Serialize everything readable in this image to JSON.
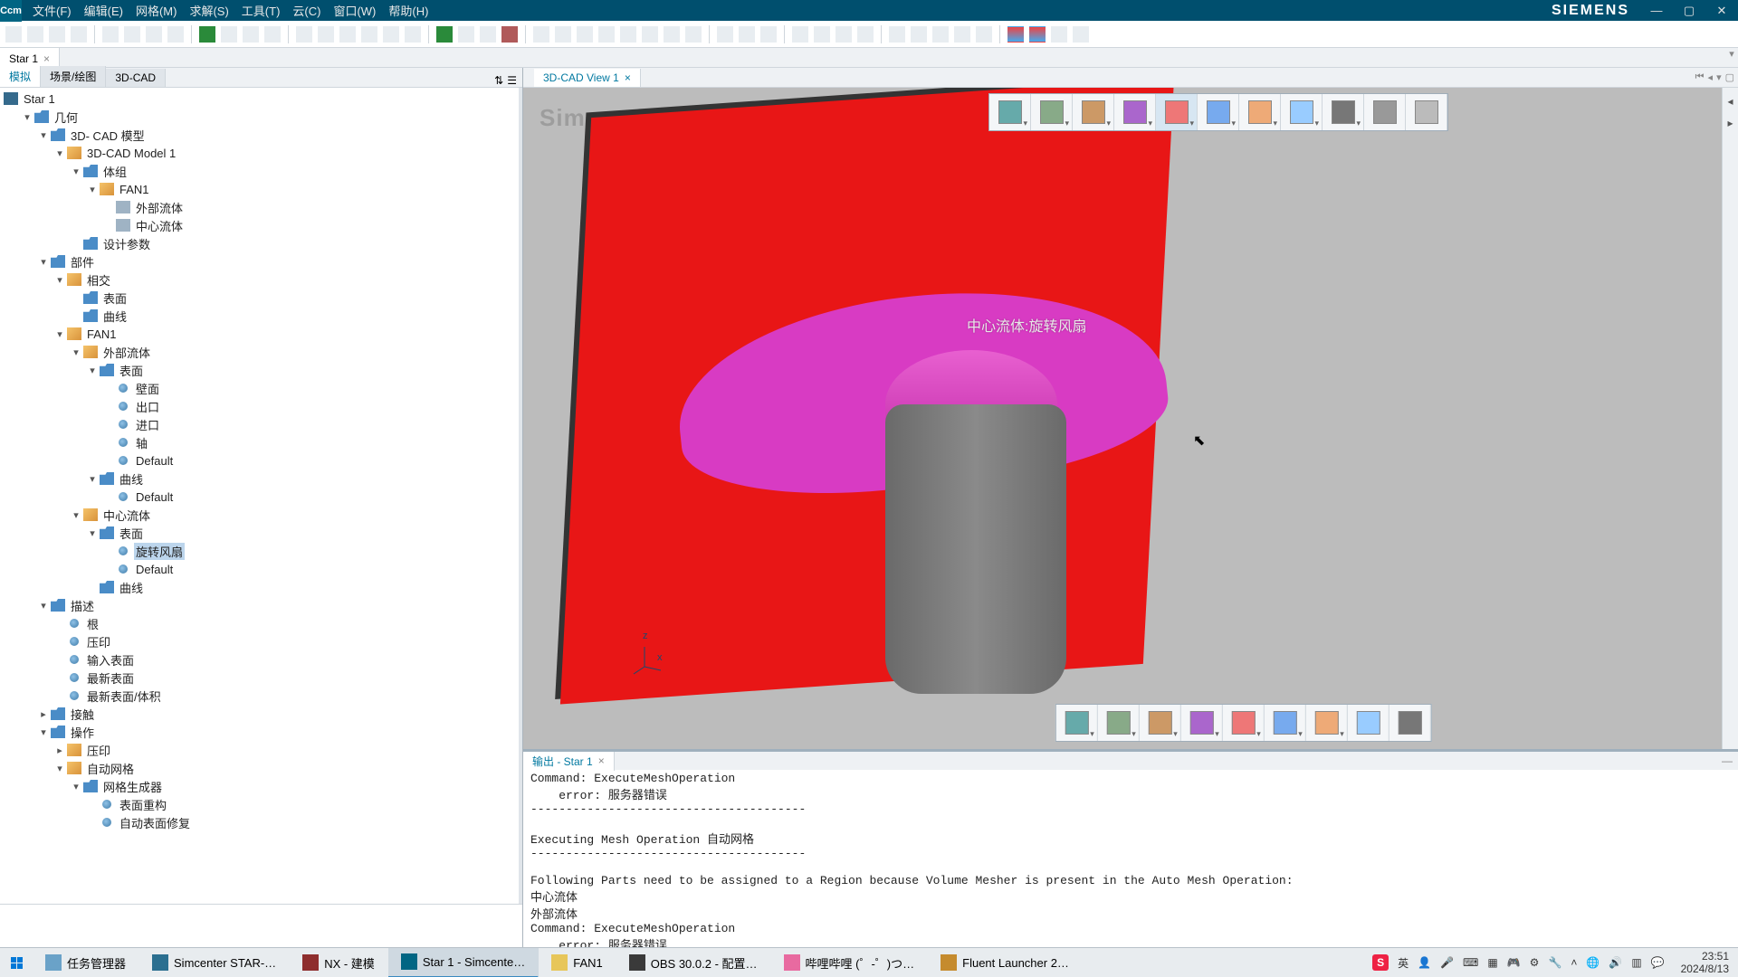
{
  "title_menus": [
    "文件(F)",
    "编辑(E)",
    "网格(M)",
    "求解(S)",
    "工具(T)",
    "云(C)",
    "窗口(W)",
    "帮助(H)"
  ],
  "brand": "SIEMENS",
  "doc_tab": "Star 1",
  "left_tabs": [
    "模拟",
    "场景/绘图",
    "3D-CAD"
  ],
  "view_tab": "3D-CAD View 1",
  "watermark": "Simcenter S",
  "model_label": "中心流体:旋转风扇",
  "triad": {
    "z": "z",
    "x": "x"
  },
  "output_tab": "输出 - Star 1",
  "output_lines": [
    "Command: ExecuteMeshOperation",
    "    error: 服务器错误",
    "---------------------------------------",
    "",
    "Executing Mesh Operation 自动网格",
    "---------------------------------------",
    "",
    "Following Parts need to be assigned to a Region because Volume Mesher is present in the Auto Mesh Operation:",
    "中心流体",
    "外部流体",
    "Command: ExecuteMeshOperation",
    "    error: 服务器错误"
  ],
  "tree": {
    "root": "Star 1",
    "nodes": [
      {
        "d": 1,
        "exp": "-",
        "ico": "folder",
        "t": "几何"
      },
      {
        "d": 2,
        "exp": "-",
        "ico": "folder",
        "t": "3D- CAD 模型"
      },
      {
        "d": 3,
        "exp": "-",
        "ico": "cube",
        "t": "3D-CAD Model 1"
      },
      {
        "d": 4,
        "exp": "-",
        "ico": "folder",
        "t": "体组"
      },
      {
        "d": 5,
        "exp": "-",
        "ico": "cube",
        "t": "FAN1"
      },
      {
        "d": 6,
        "exp": "",
        "ico": "doc",
        "t": "外部流体"
      },
      {
        "d": 6,
        "exp": "",
        "ico": "doc",
        "t": "中心流体"
      },
      {
        "d": 4,
        "exp": "",
        "ico": "folder",
        "t": "设计参数"
      },
      {
        "d": 2,
        "exp": "-",
        "ico": "folder",
        "t": "部件"
      },
      {
        "d": 3,
        "exp": "-",
        "ico": "cube",
        "t": "相交"
      },
      {
        "d": 4,
        "exp": "",
        "ico": "folder",
        "t": "表面"
      },
      {
        "d": 4,
        "exp": "",
        "ico": "folder",
        "t": "曲线"
      },
      {
        "d": 3,
        "exp": "-",
        "ico": "cube",
        "t": "FAN1"
      },
      {
        "d": 4,
        "exp": "-",
        "ico": "cube",
        "t": "外部流体"
      },
      {
        "d": 5,
        "exp": "-",
        "ico": "folder",
        "t": "表面"
      },
      {
        "d": 6,
        "exp": "",
        "ico": "leaf",
        "t": "壁面"
      },
      {
        "d": 6,
        "exp": "",
        "ico": "leaf",
        "t": "出口"
      },
      {
        "d": 6,
        "exp": "",
        "ico": "leaf",
        "t": "进口"
      },
      {
        "d": 6,
        "exp": "",
        "ico": "leaf",
        "t": "轴"
      },
      {
        "d": 6,
        "exp": "",
        "ico": "leaf",
        "t": "Default"
      },
      {
        "d": 5,
        "exp": "-",
        "ico": "folder",
        "t": "曲线"
      },
      {
        "d": 6,
        "exp": "",
        "ico": "leaf",
        "t": "Default"
      },
      {
        "d": 4,
        "exp": "-",
        "ico": "cube",
        "t": "中心流体"
      },
      {
        "d": 5,
        "exp": "-",
        "ico": "folder",
        "t": "表面"
      },
      {
        "d": 6,
        "exp": "",
        "ico": "leaf",
        "t": "旋转风扇",
        "sel": true
      },
      {
        "d": 6,
        "exp": "",
        "ico": "leaf",
        "t": "Default"
      },
      {
        "d": 5,
        "exp": "",
        "ico": "folder",
        "t": "曲线"
      },
      {
        "d": 2,
        "exp": "-",
        "ico": "folder",
        "t": "描述"
      },
      {
        "d": 3,
        "exp": "",
        "ico": "leaf",
        "t": "根"
      },
      {
        "d": 3,
        "exp": "",
        "ico": "leaf",
        "t": "压印"
      },
      {
        "d": 3,
        "exp": "",
        "ico": "leaf",
        "t": "输入表面"
      },
      {
        "d": 3,
        "exp": "",
        "ico": "leaf",
        "t": "最新表面"
      },
      {
        "d": 3,
        "exp": "",
        "ico": "leaf",
        "t": "最新表面/体积"
      },
      {
        "d": 2,
        "exp": "+",
        "ico": "folder",
        "t": "接触"
      },
      {
        "d": 2,
        "exp": "-",
        "ico": "folder",
        "t": "操作"
      },
      {
        "d": 3,
        "exp": "+",
        "ico": "cube",
        "t": "压印"
      },
      {
        "d": 3,
        "exp": "-",
        "ico": "cube",
        "t": "自动网格"
      },
      {
        "d": 4,
        "exp": "-",
        "ico": "folder",
        "t": "网格生成器"
      },
      {
        "d": 5,
        "exp": "",
        "ico": "leaf",
        "t": "表面重构"
      },
      {
        "d": 5,
        "exp": "",
        "ico": "leaf",
        "t": "自动表面修复"
      }
    ]
  },
  "taskbar": {
    "items": [
      {
        "label": "任务管理器",
        "ico": "#6aa2c8"
      },
      {
        "label": "Simcenter STAR-…",
        "ico": "#2b6f90"
      },
      {
        "label": "NX - 建模",
        "ico": "#8e2e2e"
      },
      {
        "label": "Star 1 - Simcente…",
        "ico": "#006583",
        "active": true
      },
      {
        "label": "FAN1",
        "ico": "#e7c65a"
      },
      {
        "label": "OBS 30.0.2 - 配置…",
        "ico": "#3a3a3a"
      },
      {
        "label": "哔哩哔哩 (゜-゜)つ…",
        "ico": "#e86aa0"
      },
      {
        "label": "Fluent Launcher 2…",
        "ico": "#c58b2e"
      }
    ],
    "ime": "英",
    "time": "23:51",
    "date": "2024/8/13"
  },
  "vp_top_tools": [
    "cube-outline",
    "cube-solid",
    "cube-face",
    "axes",
    "surface-highlight",
    "explode",
    "color",
    "measure",
    "zoom",
    "undo",
    "redo"
  ],
  "vp_bottom_tools": [
    "sketch",
    "line",
    "plane",
    "extrude",
    "revolve",
    "boolean",
    "capture",
    "history",
    "favorite"
  ]
}
